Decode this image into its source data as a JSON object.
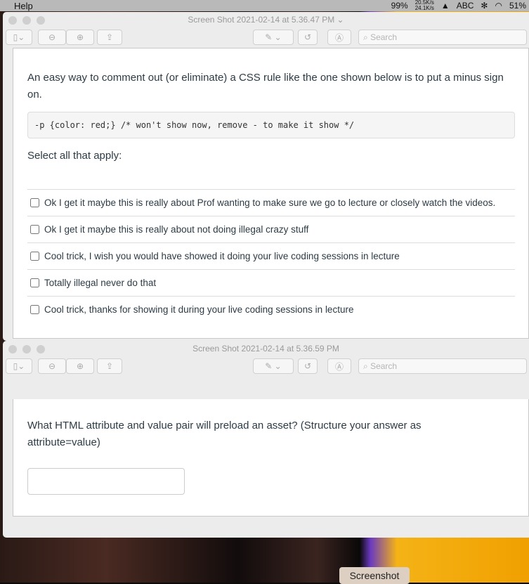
{
  "menubar": {
    "help": "Help",
    "battery_ring": "99%",
    "net_up": "20.5K/s",
    "net_down": "24.1K/s",
    "input": "ABC",
    "battery": "51%"
  },
  "window1": {
    "title": "Screen Shot 2021-02-14 at 5.36.47 PM",
    "search_placeholder": "Search",
    "question": "An easy way to comment out (or eliminate) a CSS rule like the one shown below is to put a minus sign on.",
    "code": "-p {color: red;} /* won't show now, remove - to make it show */",
    "instruction": "Select all that apply:",
    "options": [
      "Ok I get it maybe this is really about Prof wanting to make sure we go to lecture or closely watch the videos.",
      "Ok I get it maybe this is really about not doing illegal crazy stuff",
      "Cool trick, I wish you would have showed it doing your live coding sessions in lecture",
      "Totally illegal never do that",
      "Cool trick, thanks for showing it during your live coding sessions in lecture"
    ]
  },
  "window2": {
    "title": "Screen Shot 2021-02-14 at 5.36.59 PM",
    "search_placeholder": "Search",
    "question": "What HTML attribute and value pair will preload an asset? (Structure your answer as attribute=value)",
    "answer": ""
  },
  "tooltip": "Screenshot"
}
